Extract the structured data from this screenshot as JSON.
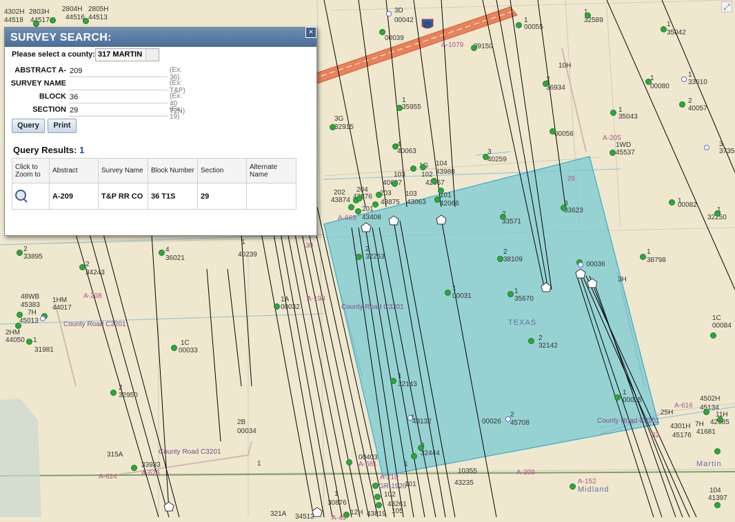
{
  "dialog": {
    "title": "SURVEY SEARCH:",
    "close_glyph": "×",
    "county_label": "Please select a county:",
    "county_value": "317 MARTIN",
    "fields": [
      {
        "label": "ABSTRACT A-",
        "value": "209",
        "example": "(Ex: 36)"
      },
      {
        "label": "SURVEY NAME",
        "value": "",
        "example": "(Ex: T&P)"
      },
      {
        "label": "BLOCK",
        "value": "36",
        "example": "(Ex: 40 T2N)"
      },
      {
        "label": "SECTION",
        "value": "29",
        "example": "(Ex: 19)"
      }
    ],
    "query_button": "Query",
    "print_button": "Print",
    "results_label": "Query Results:",
    "results_count": "1",
    "table": {
      "headers": [
        "Click to Zoom to",
        "Abstract",
        "Survey Name",
        "Block Number",
        "Section",
        "Alternate Name"
      ],
      "rows": [
        {
          "zoom_icon": "zoom-in-icon",
          "abstract": "A-209",
          "survey": "T&P RR CO",
          "block": "36 T1S",
          "section": "29",
          "alt": ""
        }
      ]
    }
  },
  "map": {
    "corner_icon": "expand-icon",
    "highlight_color": "#67c6d6",
    "labels": [
      {
        "t": "4302H",
        "c": "n"
      },
      {
        "t": "2803H",
        "c": "n"
      },
      {
        "t": "2804H",
        "c": "n"
      },
      {
        "t": "2805H",
        "c": "n"
      },
      {
        "t": "44518",
        "c": "n"
      },
      {
        "t": "44517",
        "c": "n"
      },
      {
        "t": "44516",
        "c": "n"
      },
      {
        "t": "44513",
        "c": "n"
      },
      {
        "t": "3D",
        "c": "n"
      },
      {
        "t": "00042",
        "c": "n"
      },
      {
        "t": "00039",
        "c": "n"
      },
      {
        "t": "20",
        "c": "n"
      },
      {
        "t": "A-1079",
        "c": "p"
      },
      {
        "t": "39150",
        "c": "n"
      },
      {
        "t": "1",
        "c": "n"
      },
      {
        "t": "00055",
        "c": "n"
      },
      {
        "t": "1",
        "c": "n"
      },
      {
        "t": "32589",
        "c": "n"
      },
      {
        "t": "1",
        "c": "n"
      },
      {
        "t": "35042",
        "c": "n"
      },
      {
        "t": "2",
        "c": "n"
      },
      {
        "t": "36934",
        "c": "n"
      },
      {
        "t": "1",
        "c": "n"
      },
      {
        "t": "00080",
        "c": "n"
      },
      {
        "t": "1",
        "c": "n"
      },
      {
        "t": "33610",
        "c": "n"
      },
      {
        "t": "2",
        "c": "n"
      },
      {
        "t": "40057",
        "c": "n"
      },
      {
        "t": "1",
        "c": "n"
      },
      {
        "t": "35955",
        "c": "n"
      },
      {
        "t": "3G",
        "c": "n"
      },
      {
        "t": "32915",
        "c": "n"
      },
      {
        "t": "1",
        "c": "n"
      },
      {
        "t": "35043",
        "c": "n"
      },
      {
        "t": "00056",
        "c": "n"
      },
      {
        "t": "A-205",
        "c": "p"
      },
      {
        "t": "1WD",
        "c": "n"
      },
      {
        "t": "45537",
        "c": "n"
      },
      {
        "t": "3",
        "c": "n"
      },
      {
        "t": "37355",
        "c": "n"
      },
      {
        "t": "4",
        "c": "n"
      },
      {
        "t": "40063",
        "c": "n"
      },
      {
        "t": "3",
        "c": "n"
      },
      {
        "t": "40259",
        "c": "n"
      },
      {
        "t": "1G",
        "c": "n"
      },
      {
        "t": "104",
        "c": "n"
      },
      {
        "t": "43988",
        "c": "n"
      },
      {
        "t": "103",
        "c": "n"
      },
      {
        "t": "102",
        "c": "n"
      },
      {
        "t": "40607",
        "c": "n"
      },
      {
        "t": "42067",
        "c": "n"
      },
      {
        "t": "202",
        "c": "n"
      },
      {
        "t": "43874",
        "c": "n"
      },
      {
        "t": "204",
        "c": "n"
      },
      {
        "t": "43876",
        "c": "n"
      },
      {
        "t": "203",
        "c": "n"
      },
      {
        "t": "103",
        "c": "n"
      },
      {
        "t": "101",
        "c": "n"
      },
      {
        "t": "43875",
        "c": "n"
      },
      {
        "t": "43063",
        "c": "n"
      },
      {
        "t": "42066",
        "c": "n"
      },
      {
        "t": "201",
        "c": "n"
      },
      {
        "t": "43408",
        "c": "n"
      },
      {
        "t": "A-663",
        "c": "p"
      },
      {
        "t": "2",
        "c": "n"
      },
      {
        "t": "33571",
        "c": "n"
      },
      {
        "t": "3",
        "c": "n"
      },
      {
        "t": "33623",
        "c": "n"
      },
      {
        "t": "29",
        "c": "p"
      },
      {
        "t": "1",
        "c": "n"
      },
      {
        "t": "00082",
        "c": "n"
      },
      {
        "t": "1",
        "c": "n"
      },
      {
        "t": "32250",
        "c": "n"
      },
      {
        "t": "2",
        "c": "n"
      },
      {
        "t": "33895",
        "c": "n"
      },
      {
        "t": "4",
        "c": "n"
      },
      {
        "t": "36021",
        "c": "n"
      },
      {
        "t": "1",
        "c": "n"
      },
      {
        "t": "40239",
        "c": "n"
      },
      {
        "t": "30",
        "c": "p"
      },
      {
        "t": "2",
        "c": "n"
      },
      {
        "t": "32263",
        "c": "n"
      },
      {
        "t": "2",
        "c": "n"
      },
      {
        "t": "38109",
        "c": "n"
      },
      {
        "t": "00036",
        "c": "n"
      },
      {
        "t": "1",
        "c": "n"
      },
      {
        "t": "38798",
        "c": "n"
      },
      {
        "t": "2",
        "c": "n"
      },
      {
        "t": "34243",
        "c": "n"
      },
      {
        "t": "48WB",
        "c": "n"
      },
      {
        "t": "1HM",
        "c": "n"
      },
      {
        "t": "45383",
        "c": "n"
      },
      {
        "t": "44017",
        "c": "n"
      },
      {
        "t": "7H",
        "c": "n"
      },
      {
        "t": "45013",
        "c": "n"
      },
      {
        "t": "A-208",
        "c": "p"
      },
      {
        "t": "1A",
        "c": "n"
      },
      {
        "t": "00032",
        "c": "n"
      },
      {
        "t": "A-198",
        "c": "p"
      },
      {
        "t": "1",
        "c": "n"
      },
      {
        "t": "00031",
        "c": "n"
      },
      {
        "t": "1",
        "c": "n"
      },
      {
        "t": "35670",
        "c": "n"
      },
      {
        "t": "TEXAS",
        "c": "tx"
      },
      {
        "t": "1C",
        "c": "n"
      },
      {
        "t": "00084",
        "c": "n"
      },
      {
        "t": "2HM",
        "c": "n"
      },
      {
        "t": "44050",
        "c": "n"
      },
      {
        "t": "1",
        "c": "n"
      },
      {
        "t": "31981",
        "c": "n"
      },
      {
        "t": "1C",
        "c": "n"
      },
      {
        "t": "00033",
        "c": "n"
      },
      {
        "t": "2",
        "c": "n"
      },
      {
        "t": "32142",
        "c": "n"
      },
      {
        "t": "1",
        "c": "n"
      },
      {
        "t": "32143",
        "c": "n"
      },
      {
        "t": "2",
        "c": "n"
      },
      {
        "t": "32950",
        "c": "n"
      },
      {
        "t": "1",
        "c": "n"
      },
      {
        "t": "00025",
        "c": "n"
      },
      {
        "t": "4502H",
        "c": "n"
      },
      {
        "t": "45134",
        "c": "n"
      },
      {
        "t": "25H",
        "c": "n"
      },
      {
        "t": "A-616",
        "c": "p"
      },
      {
        "t": "11H",
        "c": "n"
      },
      {
        "t": "42685",
        "c": "n"
      },
      {
        "t": "1",
        "c": "n"
      },
      {
        "t": "43132",
        "c": "n"
      },
      {
        "t": "00026",
        "c": "n"
      },
      {
        "t": "2",
        "c": "n"
      },
      {
        "t": "45708",
        "c": "n"
      },
      {
        "t": "4301H",
        "c": "n"
      },
      {
        "t": "7H",
        "c": "n"
      },
      {
        "t": "45176",
        "c": "n"
      },
      {
        "t": "41681",
        "c": "n"
      },
      {
        "t": "32",
        "c": "p"
      },
      {
        "t": "2B",
        "c": "n"
      },
      {
        "t": "00034",
        "c": "n"
      },
      {
        "t": "3",
        "c": "n"
      },
      {
        "t": "32444",
        "c": "n"
      },
      {
        "t": "315A",
        "c": "n"
      },
      {
        "t": "33933",
        "c": "n"
      },
      {
        "t": "A-625",
        "c": "p"
      },
      {
        "t": "1",
        "c": "n"
      },
      {
        "t": "00403",
        "c": "n"
      },
      {
        "t": "A-681",
        "c": "p"
      },
      {
        "t": "1",
        "c": "n"
      },
      {
        "t": "10355",
        "c": "n"
      },
      {
        "t": "A-209",
        "c": "p"
      },
      {
        "t": "Martin",
        "c": "tx"
      },
      {
        "t": "A-624",
        "c": "p"
      },
      {
        "t": "A-210",
        "c": "p"
      },
      {
        "t": "GR-1920",
        "c": "r"
      },
      {
        "t": "101",
        "c": "n"
      },
      {
        "t": "43235",
        "c": "n"
      },
      {
        "t": "A-152",
        "c": "p"
      },
      {
        "t": "Midland",
        "c": "tx"
      },
      {
        "t": "1",
        "c": "n"
      },
      {
        "t": "30876",
        "c": "n"
      },
      {
        "t": "102",
        "c": "n"
      },
      {
        "t": "43261",
        "c": "n"
      },
      {
        "t": "105",
        "c": "n"
      },
      {
        "t": "12H",
        "c": "n"
      },
      {
        "t": "43819",
        "c": "n"
      },
      {
        "t": "104",
        "c": "n"
      },
      {
        "t": "41397",
        "c": "n"
      },
      {
        "t": "321A",
        "c": "n"
      },
      {
        "t": "34512",
        "c": "n"
      },
      {
        "t": "A-49",
        "c": "p"
      },
      {
        "t": "10H",
        "c": "n"
      },
      {
        "t": "3H",
        "c": "n"
      },
      {
        "t": "County Road C3201",
        "c": "r"
      },
      {
        "t": "County Road C3201",
        "c": "r"
      },
      {
        "t": "County Road C3201",
        "c": "r"
      },
      {
        "t": "County Road C3201",
        "c": "r"
      },
      {
        "t": "County Road C1920",
        "c": "r"
      },
      {
        "t": "County Road C3201",
        "c": "r"
      }
    ]
  }
}
